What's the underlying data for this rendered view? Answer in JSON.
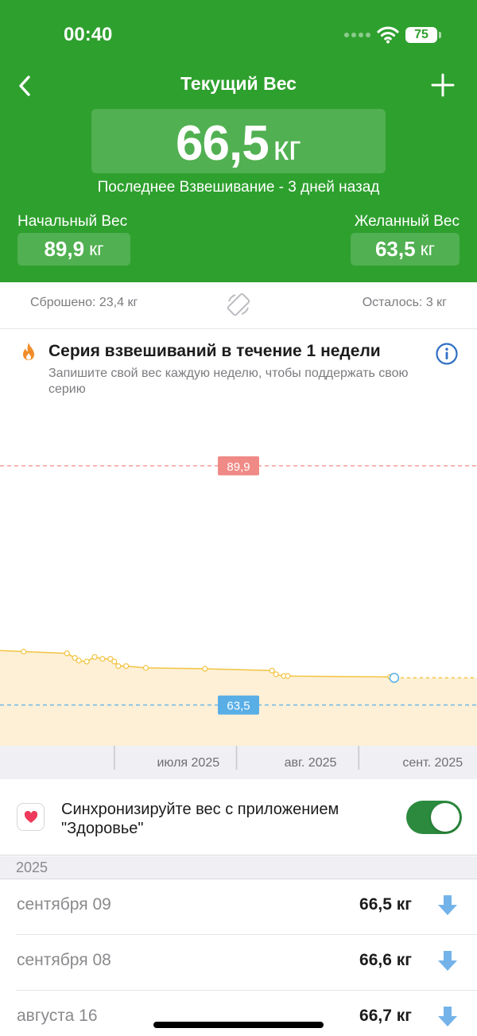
{
  "status_bar": {
    "time": "00:40",
    "battery": "75",
    "icons": [
      "signal-dots-icon",
      "wifi-icon",
      "battery-icon"
    ]
  },
  "header": {
    "title": "Текущий Вес",
    "back_icon": "chevron-left-icon",
    "add_icon": "plus-icon",
    "current_weight": "66,5",
    "unit": "кг",
    "last_weigh_in": "Последнее Взвешивание - 3 дней назад",
    "start_label": "Начальный Вес",
    "start_value": "89,9",
    "goal_label": "Желанный Вес",
    "goal_value": "63,5",
    "color": "#2ea02e"
  },
  "stats": {
    "lost": "Сброшено: 23,4 кг",
    "remaining": "Осталось: 3 кг",
    "rotate_icon": "rotate-screen-icon"
  },
  "streak": {
    "title": "Серия взвешиваний в течение 1 недели",
    "description": "Запишите свой вес каждую неделю, чтобы поддержать свою серию",
    "icon": "flame-icon",
    "info_icon": "info-icon"
  },
  "chart_data": {
    "type": "area",
    "series": [
      {
        "values": [
          {
            "date": "2025-06-07",
            "weight": 69.4
          },
          {
            "date": "2025-06-18",
            "weight": 69.2
          },
          {
            "date": "2025-06-20",
            "weight": 68.7
          },
          {
            "date": "2025-06-21",
            "weight": 68.4
          },
          {
            "date": "2025-06-23",
            "weight": 68.3
          },
          {
            "date": "2025-06-25",
            "weight": 68.8
          },
          {
            "date": "2025-06-27",
            "weight": 68.6
          },
          {
            "date": "2025-06-29",
            "weight": 68.6
          },
          {
            "date": "2025-06-30",
            "weight": 68.3
          },
          {
            "date": "2025-07-01",
            "weight": 67.8
          },
          {
            "date": "2025-07-03",
            "weight": 67.8
          },
          {
            "date": "2025-07-08",
            "weight": 67.6
          },
          {
            "date": "2025-07-23",
            "weight": 67.5
          },
          {
            "date": "2025-08-09",
            "weight": 67.3
          },
          {
            "date": "2025-08-10",
            "weight": 66.9
          },
          {
            "date": "2025-08-12",
            "weight": 66.7
          },
          {
            "date": "2025-08-13",
            "weight": 66.7
          },
          {
            "date": "2025-09-08",
            "weight": 66.6
          },
          {
            "date": "2025-09-09",
            "weight": 66.5
          }
        ],
        "color": "#f2c443",
        "fill": "#fdf0d6"
      }
    ],
    "reference_lines": [
      {
        "label": "89,9",
        "value": 89.9,
        "color": "#f08a86"
      },
      {
        "label": "63,5",
        "value": 63.5,
        "color": "#5aaee6"
      }
    ],
    "x_ticks": [
      "июля 2025",
      "авг. 2025",
      "сент. 2025"
    ],
    "x_domain": [
      "2025-06-01",
      "2025-09-30"
    ],
    "y_domain": [
      59,
      97
    ],
    "grid": false
  },
  "sync": {
    "icon": "health-heart-icon",
    "text": "Синхронизируйте вес с приложением \"Здоровье\"",
    "toggle_on": true
  },
  "history": {
    "year": "2025",
    "entries": [
      {
        "date": "сентября 09",
        "weight": "66,5 кг",
        "icon": "arrow-down-icon"
      },
      {
        "date": "сентября 08",
        "weight": "66,6 кг",
        "icon": "arrow-down-icon"
      },
      {
        "date": "августа 16",
        "weight": "66,7 кг",
        "icon": "arrow-down-icon"
      }
    ]
  }
}
